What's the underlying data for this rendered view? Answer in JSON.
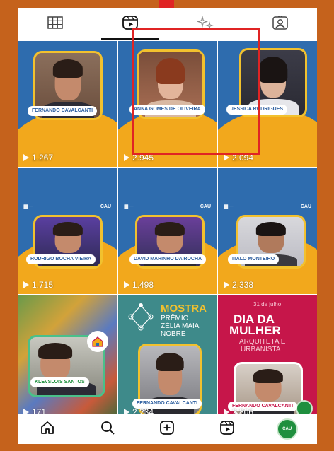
{
  "tabs": [
    {
      "name": "grid-icon",
      "active": false
    },
    {
      "name": "reels-icon",
      "active": true
    },
    {
      "name": "tags-sparkle-icon",
      "active": false
    },
    {
      "name": "tagged-person-icon",
      "active": false
    }
  ],
  "tiles": [
    {
      "nametag": "FERNANDO CAVALCANTI",
      "views": "1.267"
    },
    {
      "nametag": "ANNA GOMES DE OLIVEIRA",
      "views": "2.945"
    },
    {
      "nametag": "JESSICA RODRIGUES",
      "views": "2.094"
    },
    {
      "nametag": "RODRIGO BOCHA VIEIRA",
      "views": "1.715"
    },
    {
      "nametag": "DAVID MARINHO DA ROCHA",
      "views": "1.498"
    },
    {
      "nametag": "ITALO MONTEIRO",
      "views": "2.338"
    },
    {
      "nametag": "KLEVSLOIS SANTOS",
      "views": "171"
    },
    {
      "nametag": "FERNANDO CAVALCANTI",
      "views": "2.234"
    },
    {
      "nametag": "FERNANDO CAVALCANTI",
      "views": "2.806"
    }
  ],
  "tile8": {
    "heading": "MOSTRA",
    "line1": "PRÊMIO",
    "line2": "ZÉLIA MAIA",
    "line3": "NOBRE"
  },
  "tile9": {
    "date": "31 de julho",
    "title1": "DIA DA",
    "title2": "MULHER",
    "sub1": "ARQUITETA E",
    "sub2": "URBANISTA"
  },
  "cau_logo": "CAU",
  "colors": {
    "accent_red": "#e02424",
    "page_bg": "#c5621c",
    "tile_blue": "#2e6cae",
    "tile_yellow": "#f2a81c",
    "tile_pink": "#c6164a"
  }
}
